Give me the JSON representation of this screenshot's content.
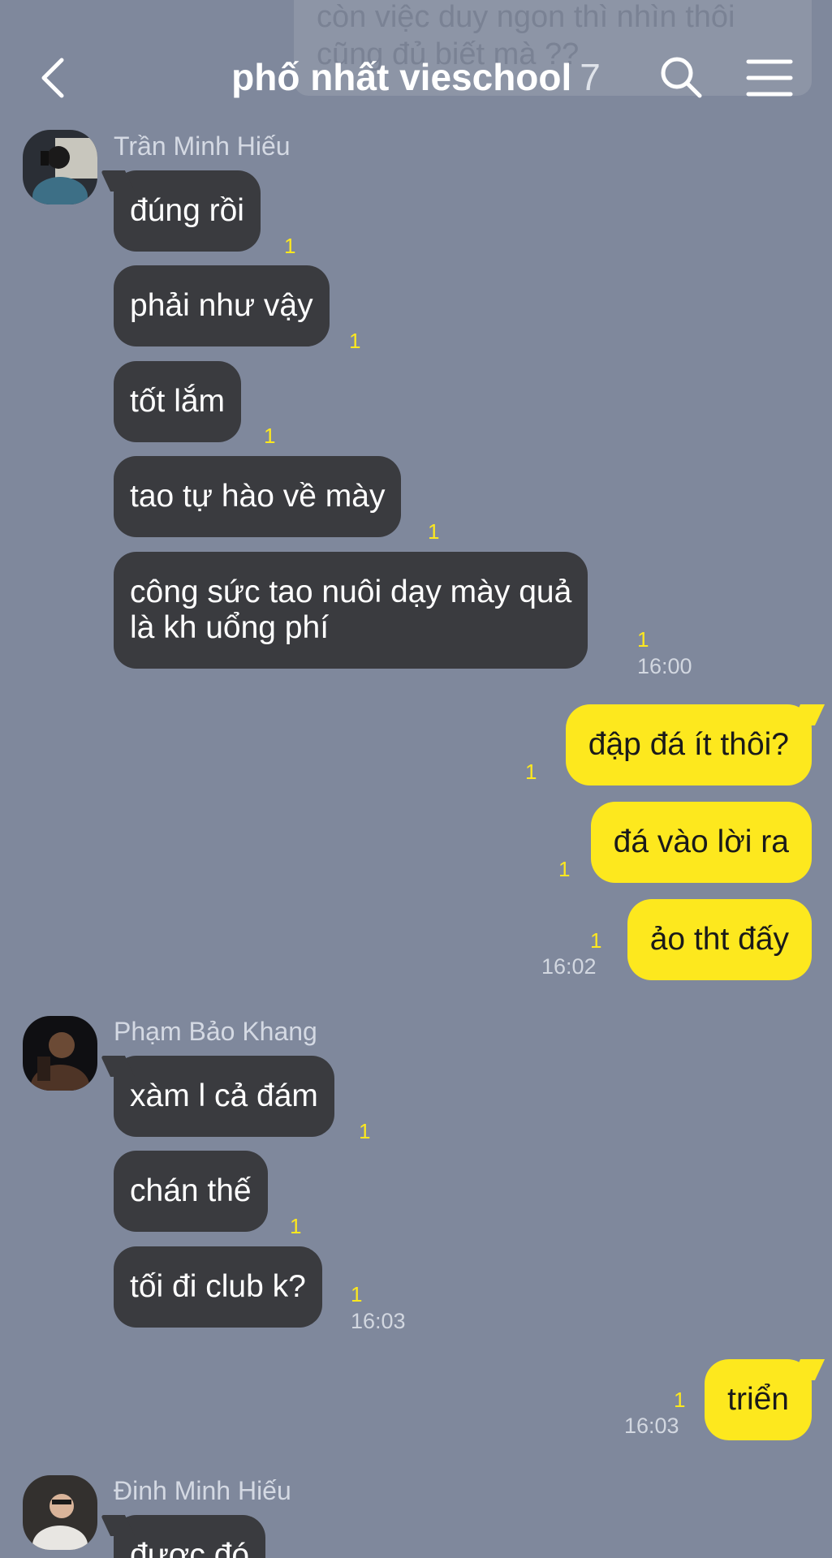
{
  "header": {
    "ghost_text": "còn việc duy ngon thì nhìn thôi cũng đủ biết mà ??",
    "title": "phố nhất vieschool",
    "member_count": "7"
  },
  "groups": [
    {
      "sender": "Trần Minh Hiếu",
      "messages": [
        {
          "text": "đúng rồi",
          "read": "1"
        },
        {
          "text": "phải như vậy",
          "read": "1"
        },
        {
          "text": "tốt lắm",
          "read": "1"
        },
        {
          "text": "tao tự hào về mày",
          "read": "1"
        },
        {
          "line1": "công sức tao nuôi dạy mày quả",
          "line2": "là kh uổng phí",
          "read": "1",
          "time": "16:00"
        }
      ]
    },
    {
      "sender": "me",
      "messages": [
        {
          "text": "đập đá ít thôi?",
          "read": "1"
        },
        {
          "text": "đá vào lời ra",
          "read": "1"
        },
        {
          "text": "ảo tht đấy",
          "read": "1",
          "time": "16:02"
        }
      ]
    },
    {
      "sender": "Phạm Bảo Khang",
      "messages": [
        {
          "text": "xàm l cả đám",
          "read": "1"
        },
        {
          "text": "chán thế",
          "read": "1"
        },
        {
          "text": "tối đi club k?",
          "read": "1",
          "time": "16:03"
        }
      ]
    },
    {
      "sender": "me",
      "messages": [
        {
          "text": "triển",
          "read": "1",
          "time": "16:03"
        }
      ]
    },
    {
      "sender": "Đinh Minh Hiếu",
      "messages": [
        {
          "text": "được đó"
        }
      ]
    }
  ],
  "colors": {
    "background": "#7f889c",
    "incoming_bubble": "#3a3b3f",
    "outgoing_bubble": "#fde81e",
    "read_count": "#fde81e"
  }
}
